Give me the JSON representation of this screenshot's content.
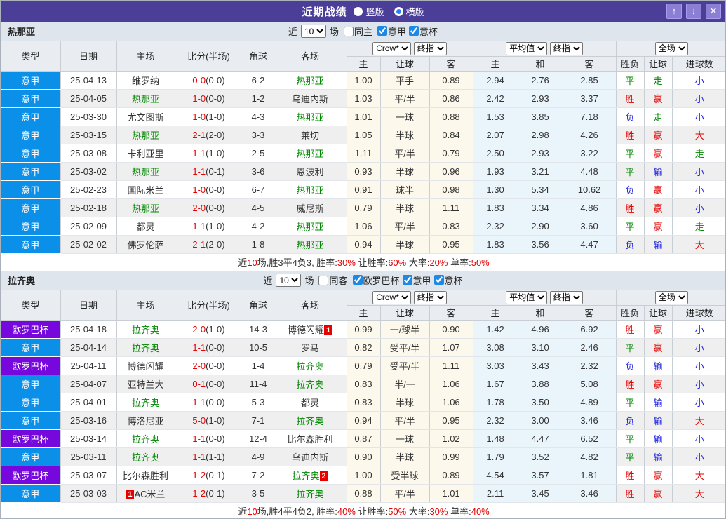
{
  "colors": {
    "titlebar": "#4a3e99",
    "serie_a": "#0a90e8",
    "europa": "#7708dd",
    "red": "#e60000",
    "green": "#008800",
    "blue": "#2020e0"
  },
  "titlebar": {
    "title": "近期战绩",
    "radios": [
      {
        "label": "竖版",
        "checked": false
      },
      {
        "label": "横版",
        "checked": true
      }
    ],
    "buttons": {
      "up": "↑",
      "down": "↓",
      "close": "✕"
    }
  },
  "table_header": {
    "col_type": "类型",
    "col_date": "日期",
    "col_home": "主场",
    "col_score": "比分(半场)",
    "col_corner": "角球",
    "col_away": "客场",
    "select_crow": "Crow*",
    "select_final1": "终指",
    "select_avg": "平均值",
    "select_final2": "终指",
    "select_fulltime": "全场",
    "sub": [
      "主",
      "让球",
      "客",
      "主",
      "和",
      "客",
      "胜负",
      "让球",
      "进球数"
    ]
  },
  "sections": [
    {
      "team": "热那亚",
      "filter": {
        "near_label": "近",
        "count": "10",
        "unit": "场",
        "same_label": "同主",
        "leagues": [
          "意甲",
          "意杯"
        ]
      },
      "rows": [
        {
          "league": "意甲",
          "lkey": "serie",
          "date": "25-04-13",
          "home": "维罗纳",
          "hg": false,
          "score": "0-0",
          "half": "(0-0)",
          "corner": "6-2",
          "away": "热那亚",
          "ag": true,
          "odds": [
            "1.00",
            "平手",
            "0.89",
            "2.94",
            "2.76",
            "2.85"
          ],
          "res": [
            [
              "平",
              "g"
            ],
            [
              "走",
              "g"
            ],
            [
              "小",
              "b"
            ]
          ]
        },
        {
          "league": "意甲",
          "lkey": "serie",
          "date": "25-04-05",
          "home": "热那亚",
          "hg": true,
          "score": "1-0",
          "half": "(0-0)",
          "corner": "1-2",
          "away": "乌迪内斯",
          "ag": false,
          "odds": [
            "1.03",
            "平/半",
            "0.86",
            "2.42",
            "2.93",
            "3.37"
          ],
          "res": [
            [
              "胜",
              "r"
            ],
            [
              "赢",
              "r"
            ],
            [
              "小",
              "b"
            ]
          ]
        },
        {
          "league": "意甲",
          "lkey": "serie",
          "date": "25-03-30",
          "home": "尤文图斯",
          "hg": false,
          "score": "1-0",
          "half": "(1-0)",
          "corner": "4-3",
          "away": "热那亚",
          "ag": true,
          "odds": [
            "1.01",
            "一球",
            "0.88",
            "1.53",
            "3.85",
            "7.18"
          ],
          "res": [
            [
              "负",
              "b"
            ],
            [
              "走",
              "g"
            ],
            [
              "小",
              "b"
            ]
          ]
        },
        {
          "league": "意甲",
          "lkey": "serie",
          "date": "25-03-15",
          "home": "热那亚",
          "hg": true,
          "score": "2-1",
          "half": "(2-0)",
          "corner": "3-3",
          "away": "莱切",
          "ag": false,
          "odds": [
            "1.05",
            "半球",
            "0.84",
            "2.07",
            "2.98",
            "4.26"
          ],
          "res": [
            [
              "胜",
              "r"
            ],
            [
              "赢",
              "r"
            ],
            [
              "大",
              "r"
            ]
          ]
        },
        {
          "league": "意甲",
          "lkey": "serie",
          "date": "25-03-08",
          "home": "卡利亚里",
          "hg": false,
          "score": "1-1",
          "half": "(1-0)",
          "corner": "2-5",
          "away": "热那亚",
          "ag": true,
          "odds": [
            "1.11",
            "平/半",
            "0.79",
            "2.50",
            "2.93",
            "3.22"
          ],
          "res": [
            [
              "平",
              "g"
            ],
            [
              "赢",
              "r"
            ],
            [
              "走",
              "g"
            ]
          ]
        },
        {
          "league": "意甲",
          "lkey": "serie",
          "date": "25-03-02",
          "home": "热那亚",
          "hg": true,
          "score": "1-1",
          "half": "(0-1)",
          "corner": "3-6",
          "away": "恩波利",
          "ag": false,
          "odds": [
            "0.93",
            "半球",
            "0.96",
            "1.93",
            "3.21",
            "4.48"
          ],
          "res": [
            [
              "平",
              "g"
            ],
            [
              "输",
              "b"
            ],
            [
              "小",
              "b"
            ]
          ]
        },
        {
          "league": "意甲",
          "lkey": "serie",
          "date": "25-02-23",
          "home": "国际米兰",
          "hg": false,
          "score": "1-0",
          "half": "(0-0)",
          "corner": "6-7",
          "away": "热那亚",
          "ag": true,
          "odds": [
            "0.91",
            "球半",
            "0.98",
            "1.30",
            "5.34",
            "10.62"
          ],
          "res": [
            [
              "负",
              "b"
            ],
            [
              "赢",
              "r"
            ],
            [
              "小",
              "b"
            ]
          ]
        },
        {
          "league": "意甲",
          "lkey": "serie",
          "date": "25-02-18",
          "home": "热那亚",
          "hg": true,
          "score": "2-0",
          "half": "(0-0)",
          "corner": "4-5",
          "away": "威尼斯",
          "ag": false,
          "odds": [
            "0.79",
            "半球",
            "1.11",
            "1.83",
            "3.34",
            "4.86"
          ],
          "res": [
            [
              "胜",
              "r"
            ],
            [
              "赢",
              "r"
            ],
            [
              "小",
              "b"
            ]
          ]
        },
        {
          "league": "意甲",
          "lkey": "serie",
          "date": "25-02-09",
          "home": "都灵",
          "hg": false,
          "score": "1-1",
          "half": "(1-0)",
          "corner": "4-2",
          "away": "热那亚",
          "ag": true,
          "odds": [
            "1.06",
            "平/半",
            "0.83",
            "2.32",
            "2.90",
            "3.60"
          ],
          "res": [
            [
              "平",
              "g"
            ],
            [
              "赢",
              "r"
            ],
            [
              "走",
              "g"
            ]
          ]
        },
        {
          "league": "意甲",
          "lkey": "serie",
          "date": "25-02-02",
          "home": "佛罗伦萨",
          "hg": false,
          "score": "2-1",
          "half": "(2-0)",
          "corner": "1-8",
          "away": "热那亚",
          "ag": true,
          "odds": [
            "0.94",
            "半球",
            "0.95",
            "1.83",
            "3.56",
            "4.47"
          ],
          "res": [
            [
              "负",
              "b"
            ],
            [
              "输",
              "b"
            ],
            [
              "大",
              "r"
            ]
          ]
        }
      ],
      "summary": [
        [
          "近",
          "k"
        ],
        [
          "10",
          "r"
        ],
        [
          "场,胜3平4负3, 胜率:",
          "k"
        ],
        [
          "30%",
          "r"
        ],
        [
          " 让胜率:",
          "k"
        ],
        [
          "60%",
          "r"
        ],
        [
          " 大率:",
          "k"
        ],
        [
          "20%",
          "r"
        ],
        [
          " 单率:",
          "k"
        ],
        [
          "50%",
          "r"
        ]
      ]
    },
    {
      "team": "拉齐奥",
      "filter": {
        "near_label": "近",
        "count": "10",
        "unit": "场",
        "same_label": "同客",
        "leagues": [
          "欧罗巴杯",
          "意甲",
          "意杯"
        ]
      },
      "rows": [
        {
          "league": "欧罗巴杯",
          "lkey": "europa",
          "date": "25-04-18",
          "home": "拉齐奥",
          "hg": true,
          "score": "2-0",
          "half": "(1-0)",
          "corner": "14-3",
          "away": "博德闪耀",
          "ag": false,
          "abadge": "1",
          "odds": [
            "0.99",
            "一/球半",
            "0.90",
            "1.42",
            "4.96",
            "6.92"
          ],
          "res": [
            [
              "胜",
              "r"
            ],
            [
              "赢",
              "r"
            ],
            [
              "小",
              "b"
            ]
          ]
        },
        {
          "league": "意甲",
          "lkey": "serie",
          "date": "25-04-14",
          "home": "拉齐奥",
          "hg": true,
          "score": "1-1",
          "half": "(0-0)",
          "corner": "10-5",
          "away": "罗马",
          "ag": false,
          "odds": [
            "0.82",
            "受平/半",
            "1.07",
            "3.08",
            "3.10",
            "2.46"
          ],
          "res": [
            [
              "平",
              "g"
            ],
            [
              "赢",
              "r"
            ],
            [
              "小",
              "b"
            ]
          ]
        },
        {
          "league": "欧罗巴杯",
          "lkey": "europa",
          "date": "25-04-11",
          "home": "博德闪耀",
          "hg": false,
          "score": "2-0",
          "half": "(0-0)",
          "corner": "1-4",
          "away": "拉齐奥",
          "ag": true,
          "odds": [
            "0.79",
            "受平/半",
            "1.11",
            "3.03",
            "3.43",
            "2.32"
          ],
          "res": [
            [
              "负",
              "b"
            ],
            [
              "输",
              "b"
            ],
            [
              "小",
              "b"
            ]
          ]
        },
        {
          "league": "意甲",
          "lkey": "serie",
          "date": "25-04-07",
          "home": "亚特兰大",
          "hg": false,
          "score": "0-1",
          "half": "(0-0)",
          "corner": "11-4",
          "away": "拉齐奥",
          "ag": true,
          "odds": [
            "0.83",
            "半/一",
            "1.06",
            "1.67",
            "3.88",
            "5.08"
          ],
          "res": [
            [
              "胜",
              "r"
            ],
            [
              "赢",
              "r"
            ],
            [
              "小",
              "b"
            ]
          ]
        },
        {
          "league": "意甲",
          "lkey": "serie",
          "date": "25-04-01",
          "home": "拉齐奥",
          "hg": true,
          "score": "1-1",
          "half": "(0-0)",
          "corner": "5-3",
          "away": "都灵",
          "ag": false,
          "odds": [
            "0.83",
            "半球",
            "1.06",
            "1.78",
            "3.50",
            "4.89"
          ],
          "res": [
            [
              "平",
              "g"
            ],
            [
              "输",
              "b"
            ],
            [
              "小",
              "b"
            ]
          ]
        },
        {
          "league": "意甲",
          "lkey": "serie",
          "date": "25-03-16",
          "home": "博洛尼亚",
          "hg": false,
          "score": "5-0",
          "half": "(1-0)",
          "corner": "7-1",
          "away": "拉齐奥",
          "ag": true,
          "odds": [
            "0.94",
            "平/半",
            "0.95",
            "2.32",
            "3.00",
            "3.46"
          ],
          "res": [
            [
              "负",
              "b"
            ],
            [
              "输",
              "b"
            ],
            [
              "大",
              "r"
            ]
          ]
        },
        {
          "league": "欧罗巴杯",
          "lkey": "europa",
          "date": "25-03-14",
          "home": "拉齐奥",
          "hg": true,
          "score": "1-1",
          "half": "(0-0)",
          "corner": "12-4",
          "away": "比尔森胜利",
          "ag": false,
          "odds": [
            "0.87",
            "一球",
            "1.02",
            "1.48",
            "4.47",
            "6.52"
          ],
          "res": [
            [
              "平",
              "g"
            ],
            [
              "输",
              "b"
            ],
            [
              "小",
              "b"
            ]
          ]
        },
        {
          "league": "意甲",
          "lkey": "serie",
          "date": "25-03-11",
          "home": "拉齐奥",
          "hg": true,
          "score": "1-1",
          "half": "(1-1)",
          "corner": "4-9",
          "away": "乌迪内斯",
          "ag": false,
          "odds": [
            "0.90",
            "半球",
            "0.99",
            "1.79",
            "3.52",
            "4.82"
          ],
          "res": [
            [
              "平",
              "g"
            ],
            [
              "输",
              "b"
            ],
            [
              "小",
              "b"
            ]
          ]
        },
        {
          "league": "欧罗巴杯",
          "lkey": "europa",
          "date": "25-03-07",
          "home": "比尔森胜利",
          "hg": false,
          "score": "1-2",
          "half": "(0-1)",
          "corner": "7-2",
          "away": "拉齐奥",
          "ag": true,
          "abadge": "2",
          "odds": [
            "1.00",
            "受半球",
            "0.89",
            "4.54",
            "3.57",
            "1.81"
          ],
          "res": [
            [
              "胜",
              "r"
            ],
            [
              "赢",
              "r"
            ],
            [
              "大",
              "r"
            ]
          ]
        },
        {
          "league": "意甲",
          "lkey": "serie",
          "date": "25-03-03",
          "home": "AC米兰",
          "hg": false,
          "hbadge": "1",
          "score": "1-2",
          "half": "(0-1)",
          "corner": "3-5",
          "away": "拉齐奥",
          "ag": true,
          "odds": [
            "0.88",
            "平/半",
            "1.01",
            "2.11",
            "3.45",
            "3.46"
          ],
          "res": [
            [
              "胜",
              "r"
            ],
            [
              "赢",
              "r"
            ],
            [
              "大",
              "r"
            ]
          ]
        }
      ],
      "summary": [
        [
          "近",
          "k"
        ],
        [
          "10",
          "r"
        ],
        [
          "场,胜4平4负2, 胜率:",
          "k"
        ],
        [
          "40%",
          "r"
        ],
        [
          " 让胜率:",
          "k"
        ],
        [
          "50%",
          "r"
        ],
        [
          " 大率:",
          "k"
        ],
        [
          "30%",
          "r"
        ],
        [
          " 单率:",
          "k"
        ],
        [
          "40%",
          "r"
        ]
      ]
    }
  ]
}
